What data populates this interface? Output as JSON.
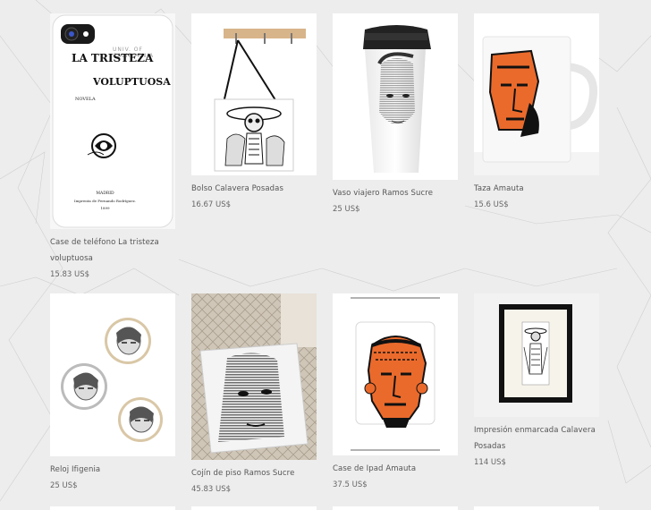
{
  "products": [
    {
      "title": "Case de teléfono La tristeza voluptuosa",
      "price": "15.83 US$",
      "icon": "phone-case-icon"
    },
    {
      "title": "Bolso Calavera Posadas",
      "price": "16.67 US$",
      "icon": "tote-bag-icon"
    },
    {
      "title": "Vaso viajero Ramos Sucre",
      "price": "25 US$",
      "icon": "travel-mug-icon"
    },
    {
      "title": "Taza Amauta",
      "price": "15.6 US$",
      "icon": "mug-icon"
    },
    {
      "title": "Reloj Ifigenia",
      "price": "25 US$",
      "icon": "pins-icon"
    },
    {
      "title": "Cojín de piso Ramos Sucre",
      "price": "45.83 US$",
      "icon": "floor-pillow-icon"
    },
    {
      "title": "Case de Ipad Amauta",
      "price": "37.5 US$",
      "icon": "ipad-case-icon"
    },
    {
      "title": "Impresión enmarcada Calavera Posadas",
      "price": "114 US$",
      "icon": "framed-print-icon"
    }
  ],
  "book_cover": {
    "title_line1": "LA TRISTEZA",
    "title_line2": "VOLUPTUOSA",
    "subtitle": "NOVELA",
    "city": "MADRID",
    "publisher": "Imprenta de Fernando Rodríguez.",
    "year": "1899",
    "stamp": "UNIV. OF CALIFORNIA"
  },
  "colors": {
    "background": "#ededed",
    "accent_orange": "#ea6a2c",
    "text": "#555555"
  }
}
